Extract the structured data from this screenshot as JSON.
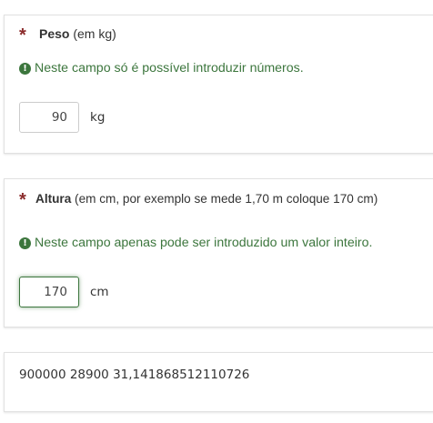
{
  "peso": {
    "asterisk": "*",
    "title": "Peso",
    "subtitle": " (em kg)",
    "tip": "Neste campo só é possível introduzir números.",
    "tip_icon": "!",
    "value": "90",
    "unit": "kg"
  },
  "altura": {
    "asterisk": "*",
    "title": "Altura",
    "subtitle": " (em cm, por exemplo se mede 1,70 m coloque 170 cm)",
    "tip": "Neste campo apenas pode ser introduzido um valor inteiro.",
    "tip_icon": "!",
    "value": "170",
    "unit": "cm"
  },
  "result": {
    "text": "900000 28900 31,141868512110726"
  },
  "colors": {
    "tip_green": "#3c763d",
    "asterisk_red": "#8b2b2b",
    "focus_border": "#3c763d"
  }
}
